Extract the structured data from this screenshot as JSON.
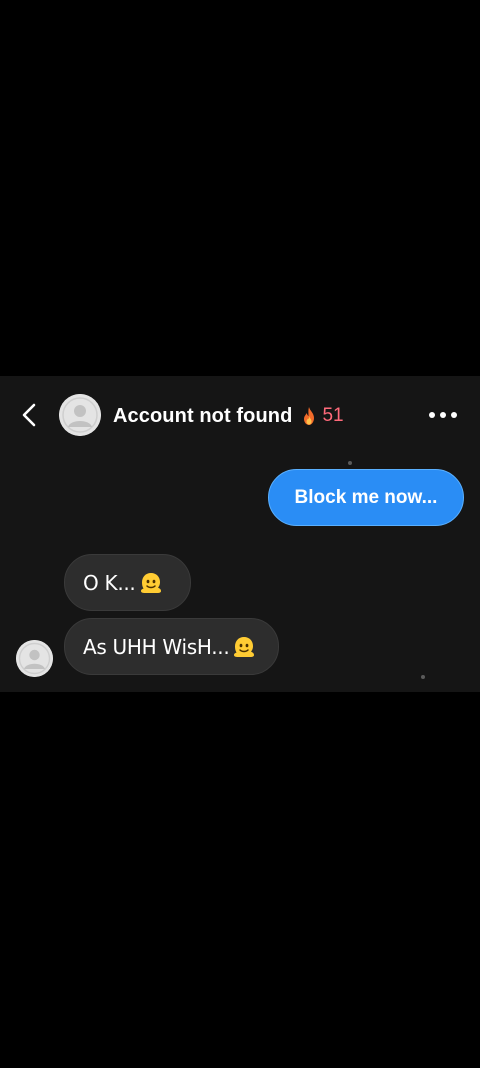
{
  "header": {
    "back_icon": "chevron-left-icon",
    "avatar_icon": "default-avatar-icon",
    "title": "Account not found",
    "streak_icon": "fire-icon",
    "streak_count": "51",
    "more_icon": "more-horizontal-icon"
  },
  "messages": [
    {
      "direction": "sent",
      "text": "Block me now..."
    },
    {
      "direction": "received",
      "text": "O K...",
      "emoji": "melting-face-emoji"
    },
    {
      "direction": "received",
      "text": "As UHH WisH...",
      "emoji": "melting-face-emoji"
    }
  ],
  "colors": {
    "background": "#000000",
    "chat_panel": "#151515",
    "sent_bubble": "#2a8df5",
    "received_bubble": "#2d2d2d",
    "streak": "#ff6a7a"
  }
}
